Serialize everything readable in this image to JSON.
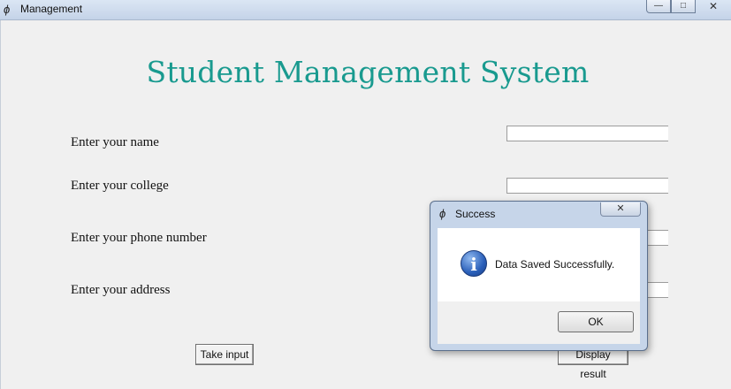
{
  "window": {
    "title": "Management",
    "controls": {
      "minimize": "—",
      "maximize": "□",
      "close": "✕"
    }
  },
  "form": {
    "heading": "Student Management System",
    "fields": [
      {
        "label": "Enter your name",
        "value": ""
      },
      {
        "label": "Enter your college",
        "value": ""
      },
      {
        "label": "Enter your phone number",
        "value": ""
      },
      {
        "label": "Enter your address",
        "value": ""
      }
    ],
    "buttons": {
      "take_input": "Take input",
      "display_result": "Display result"
    }
  },
  "dialog": {
    "title": "Success",
    "message": "Data Saved Successfully.",
    "icon": "information-icon",
    "icon_glyph": "i",
    "close_glyph": "✕",
    "ok_label": "OK"
  },
  "colors": {
    "heading": "#199a8f",
    "titlebar": "#c4d3e8",
    "info_icon": "#2a5fb9"
  }
}
